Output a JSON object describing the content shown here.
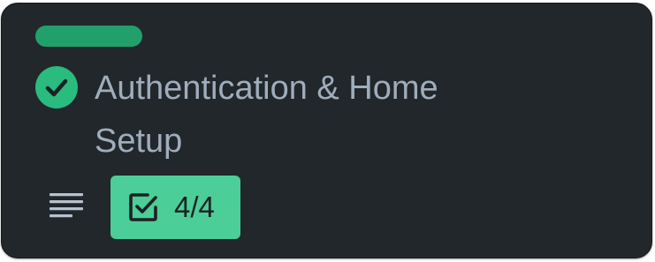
{
  "card": {
    "cover_color": "#22a06b",
    "status_icon": "check-circle-icon",
    "status_color": "#2abb7f",
    "title": "Authentication & Home Setup",
    "badges": {
      "description_icon": "description-lines-icon",
      "checklist_icon": "checkbox-checked-icon",
      "checklist_text": "4/4",
      "checklist_color": "#4bce97"
    }
  }
}
